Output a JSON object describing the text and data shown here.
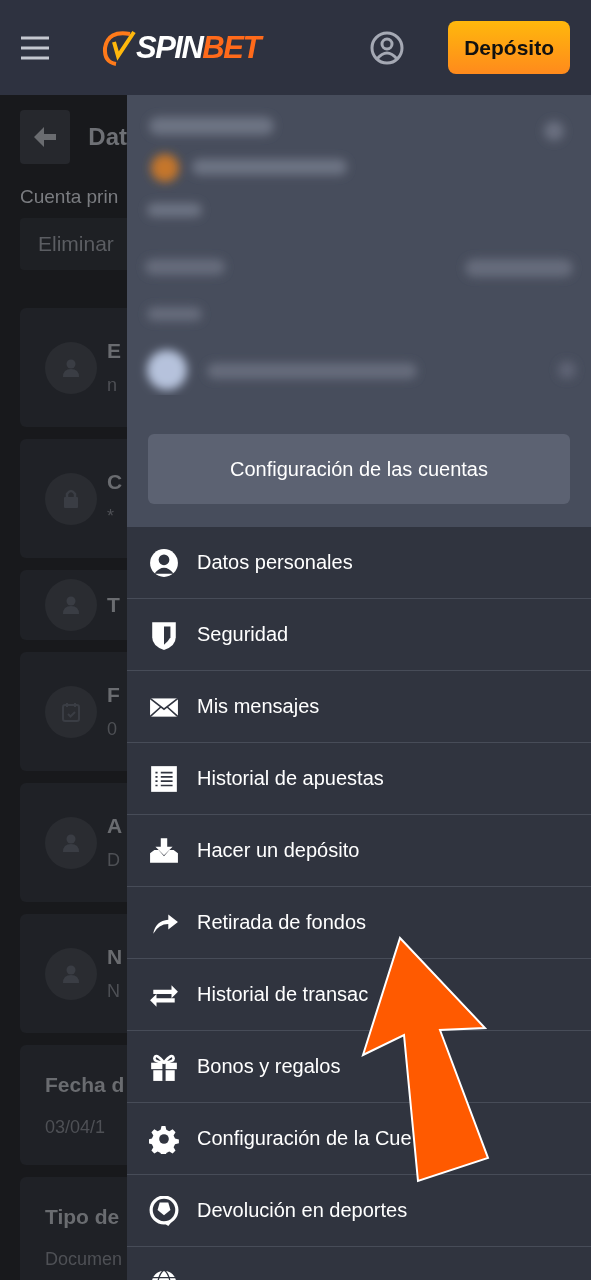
{
  "header": {
    "logo": {
      "first": "SPIN",
      "second": "BET"
    },
    "deposit_button": "Depósito"
  },
  "background_page": {
    "title": "Dat",
    "account_label": "Cuenta prin",
    "account_field": "Eliminar",
    "cards": [
      {
        "kind": "icon",
        "title": "E",
        "value": "n"
      },
      {
        "kind": "icon",
        "title": "C",
        "value": "*"
      },
      {
        "kind": "icon",
        "title": "T"
      },
      {
        "kind": "icon",
        "title": "F",
        "value": "0"
      },
      {
        "kind": "icon",
        "title": "A",
        "value": "D"
      },
      {
        "kind": "icon",
        "title": "N",
        "value": "N"
      },
      {
        "kind": "plain",
        "title": "Fecha d",
        "value": "03/04/1"
      },
      {
        "kind": "plain",
        "title": "Tipo de",
        "value": "Documen"
      }
    ]
  },
  "drawer": {
    "settings_button": "Configuración de las cuentas",
    "items": [
      {
        "label": "Datos personales"
      },
      {
        "label": "Seguridad"
      },
      {
        "label": "Mis mensajes"
      },
      {
        "label": "Historial de apuestas"
      },
      {
        "label": "Hacer un depósito"
      },
      {
        "label": "Retirada de fondos"
      },
      {
        "label": "Historial de transac"
      },
      {
        "label": "Bonos y regalos"
      },
      {
        "label": "Configuración de la Cue"
      },
      {
        "label": "Devolución en deportes"
      }
    ]
  }
}
